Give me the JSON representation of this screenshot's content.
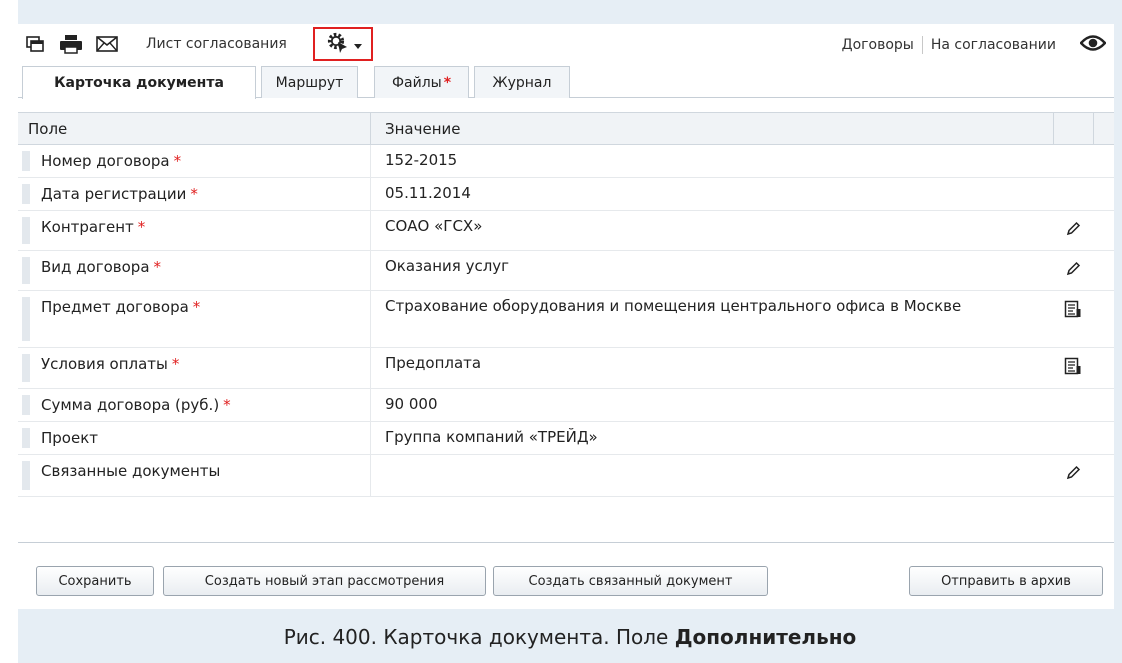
{
  "toolbar": {
    "approval_sheet_label": "Лист согласования",
    "breadcrumb": [
      "Договоры",
      "На согласовании"
    ],
    "icons": [
      "windows-icon",
      "print-icon",
      "mail-icon",
      "gear-icon",
      "dropdown-arrow-icon",
      "eye-icon"
    ]
  },
  "tabs": [
    {
      "label": "Карточка документа",
      "active": true
    },
    {
      "label": "Маршрут",
      "active": false
    },
    {
      "label": "Файлы",
      "required_mark": "*",
      "active": false
    },
    {
      "label": "Журнал",
      "active": false
    }
  ],
  "table": {
    "headers": [
      "Поле",
      "Значение"
    ],
    "required_mark": "*",
    "rows": [
      {
        "field": "Номер договора",
        "required": true,
        "value": "152-2015",
        "action": ""
      },
      {
        "field": "Дата регистрации",
        "required": true,
        "value": "05.11.2014",
        "action": ""
      },
      {
        "field": "Контрагент",
        "required": true,
        "value": "СОАО «ГСХ»",
        "action": "pencil-icon"
      },
      {
        "field": "Вид договора",
        "required": true,
        "value": "Оказания услуг",
        "action": "pencil-icon"
      },
      {
        "field": "Предмет договора",
        "required": true,
        "value": "Страхование оборудования и помещения центрального офиса в Москве",
        "action": "text-editor-icon"
      },
      {
        "field": "Условия оплаты",
        "required": true,
        "value": "Предоплата",
        "action": "text-editor-icon"
      },
      {
        "field": "Сумма договора (руб.)",
        "required": true,
        "value": "90 000",
        "action": ""
      },
      {
        "field": "Проект",
        "required": false,
        "value": "Группа компаний «ТРЕЙД»",
        "action": ""
      },
      {
        "field": "Связанные документы",
        "required": false,
        "value": "",
        "action": "pencil-icon"
      }
    ]
  },
  "buttons": {
    "save": "Сохранить",
    "new_stage": "Создать новый этап рассмотрения",
    "linked_doc": "Создать связанный документ",
    "archive": "Отправить в архив"
  },
  "caption": {
    "prefix": "Рис. 400. Карточка документа. Поле ",
    "bold": "Дополнительно"
  },
  "colors": {
    "accent_red": "#e02020",
    "background": "#e6eef5"
  }
}
